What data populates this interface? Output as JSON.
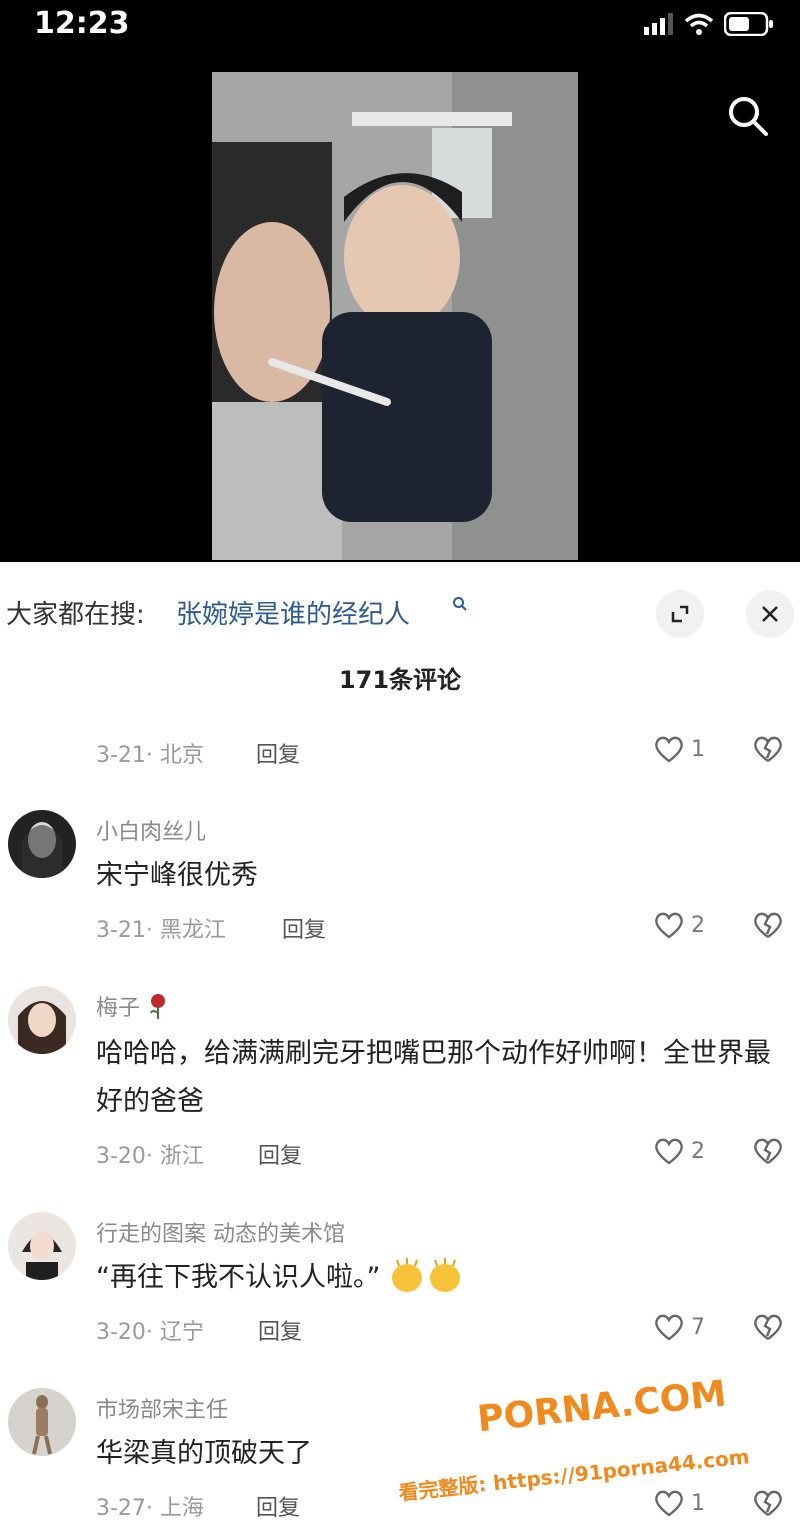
{
  "status_bar": {
    "time": "12:23"
  },
  "search_bar": {
    "prefix": "大家都在搜:",
    "term": "张婉婷是谁的经纪人"
  },
  "comments_count": "171条评论",
  "top_partial": {
    "date_location": "3-21· 北京",
    "reply": "回复",
    "likes": "1"
  },
  "comments": [
    {
      "user": "小白肉丝儿",
      "text": "宋宁峰很优秀",
      "date_location": "3-21· 黑龙江",
      "reply": "回复",
      "likes": "2"
    },
    {
      "user": "梅子",
      "text": "哈哈哈，给满满刷完牙把嘴巴那个动作好帅啊！全世界最好的爸爸",
      "date_location": "3-20· 浙江",
      "reply": "回复",
      "likes": "2"
    },
    {
      "user": "行走的图案 动态的美术馆",
      "text": "“再往下我不认识人啦。”",
      "date_location": "3-20· 辽宁",
      "reply": "回复",
      "likes": "7"
    },
    {
      "user": "市场部宋主任",
      "text": "华梁真的顶破天了",
      "date_location": "3-27· 上海",
      "reply": "回复",
      "likes": "1"
    }
  ],
  "watermark": {
    "brand": "PORNA.COM",
    "line": "看完整版: https://91porna44.com"
  },
  "colors": {
    "link": "#2d5b8f",
    "watermark": "#f08a1c"
  }
}
